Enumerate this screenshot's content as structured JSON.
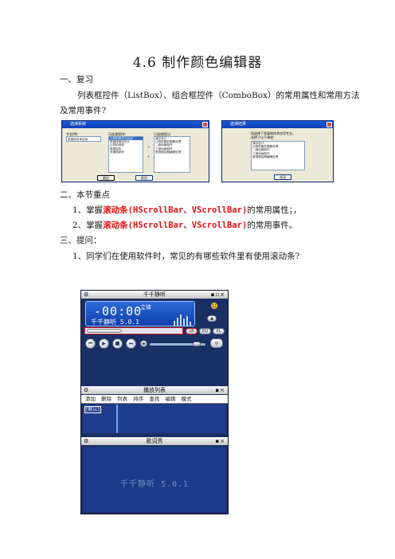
{
  "title": "4.6   制作颜色编辑器",
  "section1": {
    "heading": "一、复习",
    "para_line1": "列表框控件（ListBox）、组合框控件（ComboBox）的常用属性和常用方法",
    "para_line2": "及常用事件?"
  },
  "dialog1": {
    "title": "选课系统",
    "label_major": "专业(M)",
    "combo_value": "多媒体技术应用",
    "label_options": "可选课程(K)",
    "options": [
      "计算机数学与应用",
      "多媒体程序设计",
      "计算机网络",
      "数据结构",
      "多媒体制作"
    ],
    "label_selected": "已选课程(L)",
    "selected": [
      "演示设计",
      "计算机图形图像处理",
      "二维动画制作",
      "三维动画制作",
      "音视频后期编辑处理"
    ],
    "btn_ok": "确定",
    "btn_cancel": "取消"
  },
  "dialog2": {
    "title": "选课结果",
    "prompt_line1": "您选择了多媒体技术应用专业，",
    "prompt_line2": "选择了以下课程：",
    "results": [
      "演示设计",
      "计算机图形图像处理",
      "二维动画制作",
      "三维动画制作",
      "音视频后期编辑处理"
    ],
    "btn_close": "关闭"
  },
  "section2": {
    "heading": "二、本节重点",
    "point1_prefix": "1、掌握",
    "point1_red": "滚动条(HScrollBar、VScrollBar)",
    "point1_suffix": "的常用属性；，",
    "point2_prefix": "2、掌握",
    "point2_red": "滚动条(HScrollBar、VScrollBar)",
    "point2_suffix": "的常用事件。"
  },
  "section3": {
    "heading": "三、提问：",
    "question": "1、同学们在使用软件时，常见的有哪些软件里有使用滚动条?"
  },
  "player": {
    "title": "千千静听",
    "time": "-00:00",
    "mode": "立体",
    "name": "千千静听 5.0.1",
    "btn_pl": "PL",
    "btn_eq": "EQ",
    "btn_lrc": "LR",
    "playlist_title": "播放列表",
    "menu": [
      "添加",
      "删除",
      "列表",
      "排序",
      "查找",
      "编辑",
      "模式"
    ],
    "playlist_default": "[默认]",
    "lyric_title": "歌词秀",
    "lyric_text": "千千静听 5.0.1"
  },
  "colors": {
    "highlight": "#e01010",
    "player_bg": "#1a2f63",
    "lcd": "#2d6bd8"
  }
}
